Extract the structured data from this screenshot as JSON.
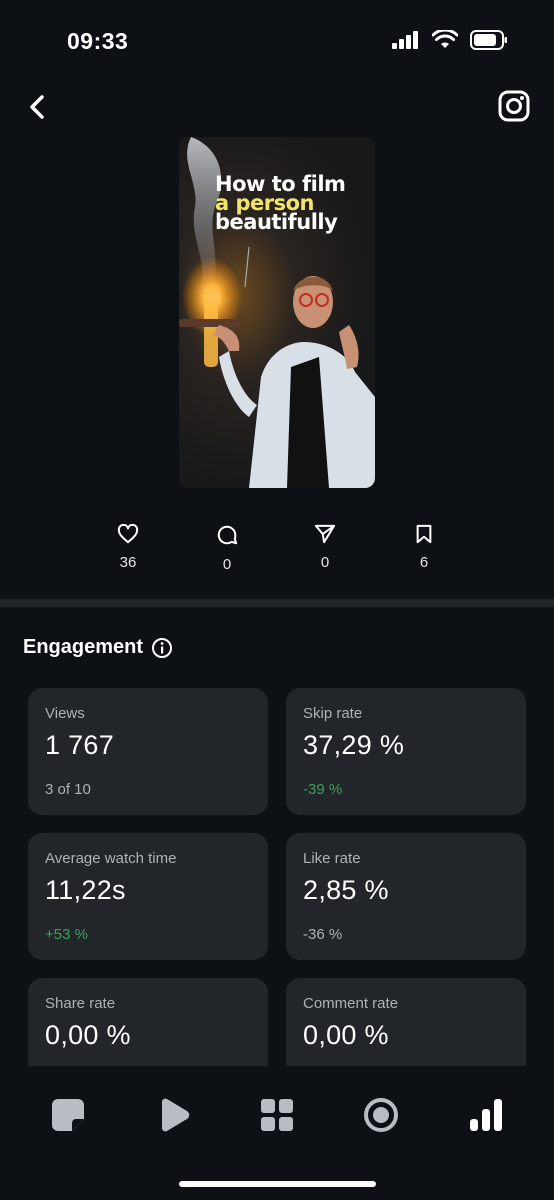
{
  "status": {
    "time": "09:33"
  },
  "post": {
    "title_line1": "How to film",
    "title_line2": "a person",
    "title_line3": "beautifully",
    "likes": "36",
    "comments": "0",
    "shares": "0",
    "saves": "6"
  },
  "engagement": {
    "title": "Engagement",
    "cards": [
      {
        "label": "Views",
        "value": "1 767",
        "sub": "3 of 10"
      },
      {
        "label": "Skip rate",
        "value": "37,29 %",
        "sub": "-39 %"
      },
      {
        "label": "Average watch time",
        "value": "11,22s",
        "sub": "+53 %"
      },
      {
        "label": "Like rate",
        "value": "2,85 %",
        "sub": "-36 %"
      },
      {
        "label": "Share rate",
        "value": "0,00 %"
      },
      {
        "label": "Comment rate",
        "value": "0,00 %"
      }
    ]
  },
  "colors": {
    "background": "#0d1015",
    "card": "#22252a",
    "positive": "#3aa35a",
    "highlight": "#f4e56a"
  },
  "nav": [
    "posts-icon",
    "reels-icon",
    "grid-icon",
    "record-icon",
    "analytics-icon"
  ]
}
